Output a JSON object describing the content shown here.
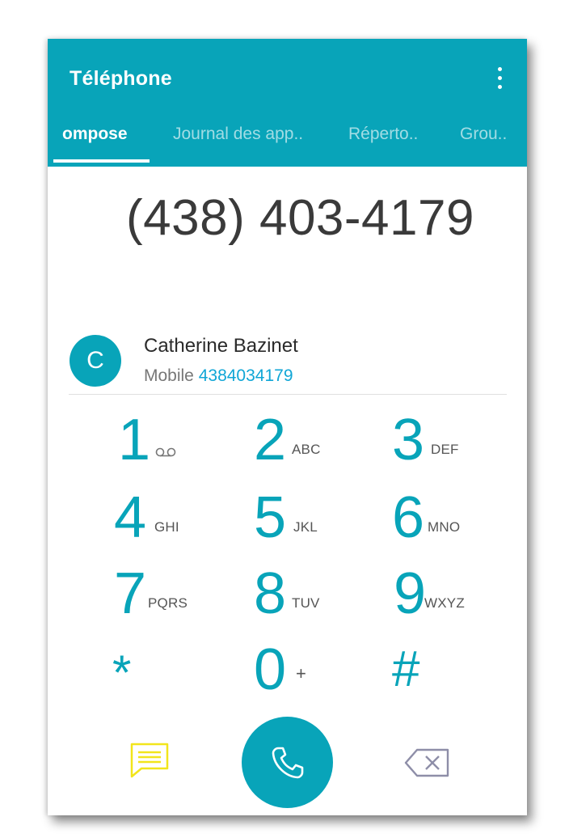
{
  "app": {
    "title": "Téléphone"
  },
  "tabs": [
    "ompose",
    "Journal des app..",
    "Réperto..",
    "Grou.."
  ],
  "dialed_number": "(438) 403-4179",
  "contact": {
    "initial": "C",
    "name": "Catherine Bazinet",
    "type": "Mobile",
    "number": "4384034179"
  },
  "keypad": [
    {
      "digit": "1",
      "letters": "",
      "icon": "voicemail-icon"
    },
    {
      "digit": "2",
      "letters": "ABC"
    },
    {
      "digit": "3",
      "letters": "DEF"
    },
    {
      "digit": "4",
      "letters": "GHI"
    },
    {
      "digit": "5",
      "letters": "JKL"
    },
    {
      "digit": "6",
      "letters": "MNO"
    },
    {
      "digit": "7",
      "letters": "PQRS"
    },
    {
      "digit": "8",
      "letters": "TUV"
    },
    {
      "digit": "9",
      "letters": "WXYZ"
    },
    {
      "digit": "*",
      "letters": ""
    },
    {
      "digit": "0",
      "letters": "+"
    },
    {
      "digit": "#",
      "letters": ""
    }
  ],
  "icons": {
    "menu": "more-vert-icon",
    "message": "message-icon",
    "call": "phone-icon",
    "backspace": "backspace-icon"
  },
  "colors": {
    "accent": "#08a4b9",
    "message_icon": "#f2e51b",
    "backspace_icon": "#8e8ea8",
    "contact_number": "#10a6d6"
  }
}
